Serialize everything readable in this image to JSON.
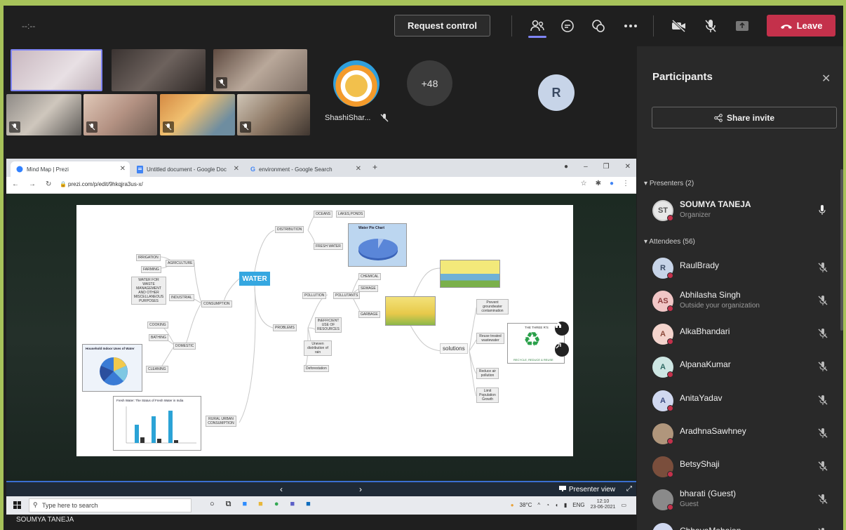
{
  "topbar": {
    "timer": "--:--",
    "request_control_label": "Request control",
    "leave_label": "Leave",
    "colors": {
      "leave": "#c4314b",
      "accent": "#7f85f5"
    }
  },
  "stage": {
    "participant_name": "ShashiShar...",
    "more_count": "+48",
    "avatar_initial": "R"
  },
  "browser": {
    "tabs": [
      {
        "label": "Mind Map | Prezi"
      },
      {
        "label": "Untitled document - Google Doc"
      },
      {
        "label": "environment - Google Search"
      }
    ],
    "url": "prezi.com/p/edit/9hkqjra3us-x/"
  },
  "mindmap": {
    "center": "WATER",
    "nodes": {
      "distribution": "DISTRIBUTION",
      "oceans": "OCEANS",
      "lakes": "LAKES,PONDS",
      "fresh_water": "FRESH WATER",
      "consumption": "CONSUMPTION",
      "irrigation": "IRRIGATION",
      "farming": "FARMING",
      "agriculture": "AGRICULTURE",
      "industrial": "INDUSTRIAL",
      "waste": "WATER FOR WASTE MANAGEMENT AND OTHER MISCELLANEOUS PURPOSES",
      "cooking": "COOKING",
      "bathing": "BATHING",
      "domestic": "DOMESTIC",
      "cleaning": "CLEANING",
      "rural_urban": "RURAL URBAN CONSUMPTION",
      "problems": "PROBLEMS",
      "pollution": "POLLUTION",
      "pollutants": "POLLUTANTS",
      "chemical": "CHEMICAL",
      "sewage": "SEWAGE",
      "garbage": "GARBAGE",
      "inefficient": "INEFFICIENT USE OF RESOURCES",
      "uneven": "Uneven distribution of rain",
      "deforestation": "Deforestation",
      "solutions": "solutions",
      "prevent": "Prevent groundwater contamination",
      "reuse": "Reuse treated wastewater",
      "reduce": "Reduce air pollution",
      "population": "Limit Population Growth",
      "pie_title": "Water Pie Chart",
      "usage_title": "Household Indoor Uses of Water",
      "bar_title": "Fresh Water: The Status of Fresh Water in India",
      "recycle_title": "THE THREE R'S",
      "recycle_sub": "RECYCLE, REDUCE & REUSE"
    }
  },
  "prezi_controls": {
    "presenter_view": "Presenter view"
  },
  "taskbar": {
    "search_placeholder": "Type here to search",
    "temperature": "38°C",
    "lang": "ENG",
    "time": "12:10",
    "date": "23-06-2021"
  },
  "share_label": "SOUMYA TANEJA",
  "participants": {
    "title": "Participants",
    "share_invite": "Share invite",
    "presenters_header": "Presenters (2)",
    "attendees_header": "Attendees (56)",
    "presenters": [
      {
        "initials": "ST",
        "name": "SOUMYA TANEJA",
        "role": "Organizer",
        "avatar_bg": "#e7e7e7",
        "avatar_fg": "#555"
      }
    ],
    "attendees": [
      {
        "initials": "R",
        "name": "RaulBrady",
        "sub": "",
        "avatar_bg": "#c7d4e8",
        "avatar_fg": "#3a4a63"
      },
      {
        "initials": "AS",
        "name": "Abhilasha Singh",
        "sub": "Outside your organization",
        "avatar_bg": "#f1c6c6",
        "avatar_fg": "#8a3b3b"
      },
      {
        "initials": "A",
        "name": "AlkaBhandari",
        "sub": "",
        "avatar_bg": "#f4d4cd",
        "avatar_fg": "#8c4a3b"
      },
      {
        "initials": "A",
        "name": "AlpanaKumar",
        "sub": "",
        "avatar_bg": "#cde6e3",
        "avatar_fg": "#2f6a64"
      },
      {
        "initials": "A",
        "name": "AnitaYadav",
        "sub": "",
        "avatar_bg": "#d0d8f0",
        "avatar_fg": "#3b4a80"
      },
      {
        "initials": "",
        "name": "AradhnaSawhney",
        "sub": "",
        "avatar_bg": "#b0967c",
        "avatar_fg": "#fff"
      },
      {
        "initials": "",
        "name": "BetsyShaji",
        "sub": "",
        "avatar_bg": "#7a4e3c",
        "avatar_fg": "#fff"
      },
      {
        "initials": "",
        "name": "bharati (Guest)",
        "sub": "Guest",
        "avatar_bg": "#8a8a8a",
        "avatar_fg": "#fff"
      },
      {
        "initials": "C",
        "name": "ChhayaMahajan",
        "sub": "",
        "avatar_bg": "#d0d8f0",
        "avatar_fg": "#3b4a80"
      }
    ]
  }
}
